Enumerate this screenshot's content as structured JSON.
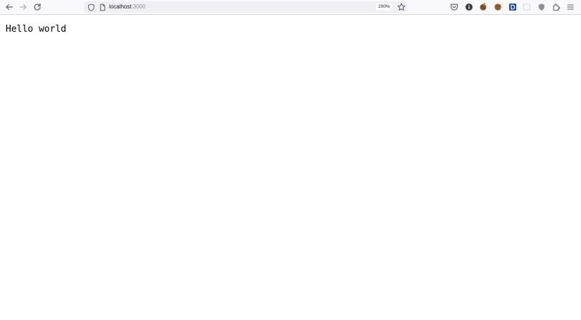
{
  "browser": {
    "url_host": "localhost",
    "url_port": ":3000",
    "zoom_level": "200%",
    "nav_icons": [
      "back-arrow-icon",
      "forward-arrow-icon",
      "reload-icon"
    ],
    "url_icons": [
      "shield-icon",
      "page-icon",
      "bookmark-star-icon"
    ],
    "toolbar_icons": [
      "pocket-icon",
      "info-icon",
      "cookie-icon",
      "cookie-alt-icon",
      "extension-d-icon",
      "screenshot-icon",
      "shield-extension-icon",
      "extensions-puzzle-icon",
      "menu-hamburger-icon"
    ],
    "colors": {
      "toolbar_bg": "#f9f9fb",
      "urlbar_bg": "#f0f0f4",
      "icon": "#5b5b66",
      "disabled_icon": "#b1b1b9",
      "extension_blue": "#1e4aa8"
    }
  },
  "page": {
    "body_text": "Hello world"
  }
}
